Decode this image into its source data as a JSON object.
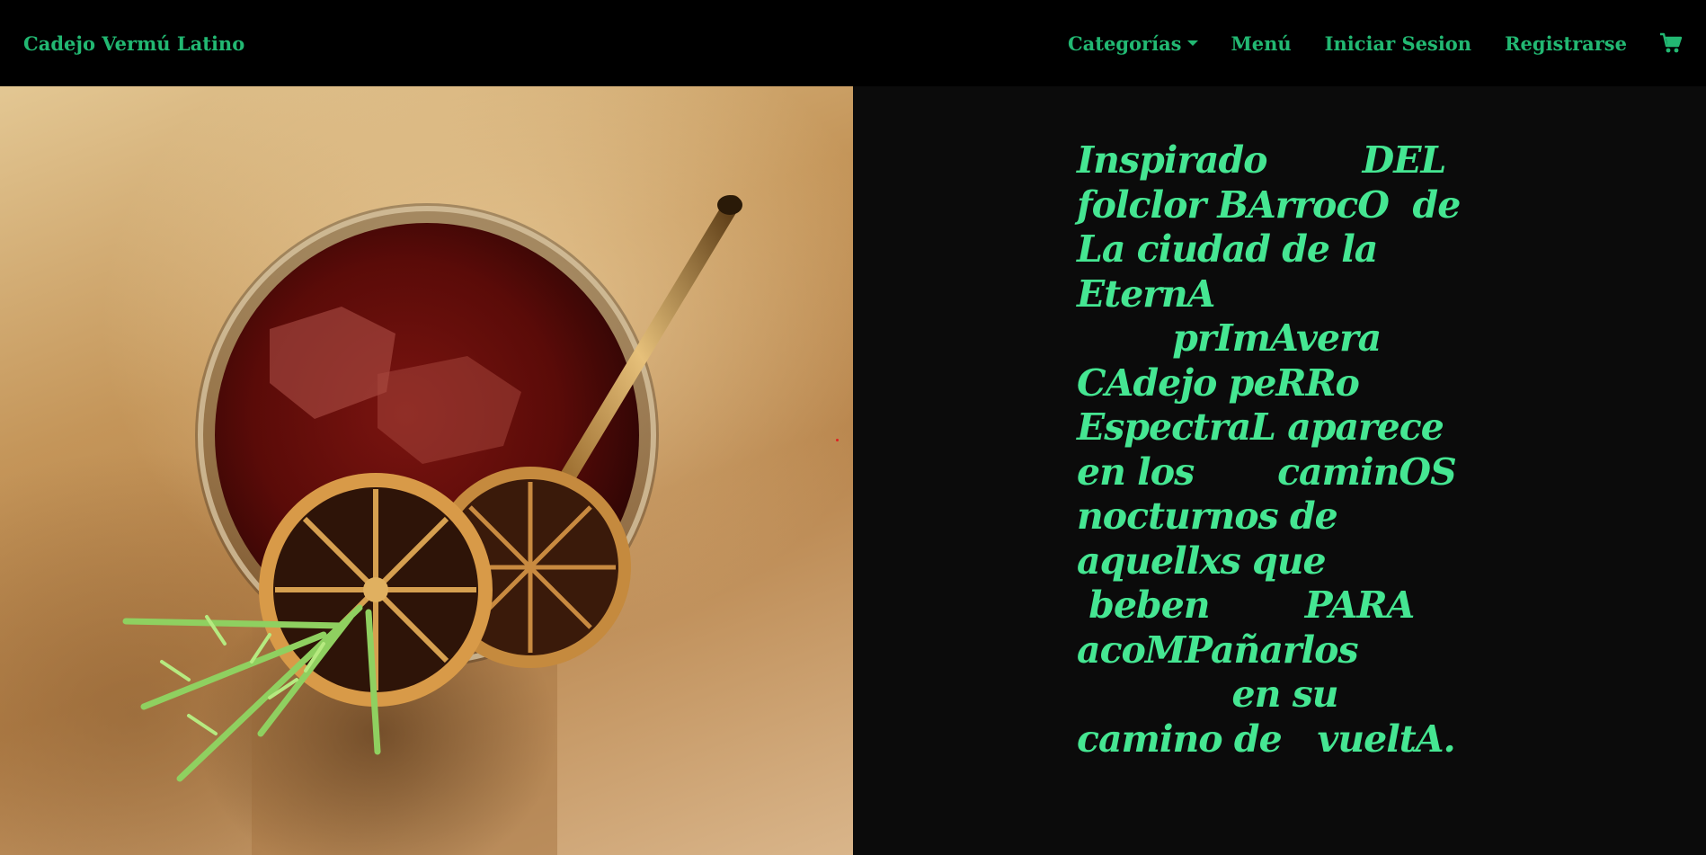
{
  "navbar": {
    "brand": "Cadejo Vermú Latino",
    "links": [
      {
        "label": "Categorías",
        "dropdown": true
      },
      {
        "label": "Menú"
      },
      {
        "label": "Iniciar Sesion"
      },
      {
        "label": "Registrarse"
      }
    ],
    "cart_icon": "shopping-cart-icon"
  },
  "hero": {
    "image_alt": "Cóctel de vermú con rodajas de limón deshidratado y romero",
    "poem_lines": [
      "Inspirado        DEL",
      "folclor BArrocO  de",
      "La ciudad de la",
      "EternA",
      "        prImAvera",
      "CAdejo peRRo",
      "EspectraL aparece",
      "en los       caminOS",
      "nocturnos de",
      "aquellxs que",
      " beben        PARA",
      "acoMPañarlos",
      "             en su",
      "camino de   vueltA."
    ]
  },
  "colors": {
    "accent": "#22b872",
    "poem_text": "#45e692",
    "nav_bg": "#000000",
    "panel_bg": "#0b0b0b"
  }
}
